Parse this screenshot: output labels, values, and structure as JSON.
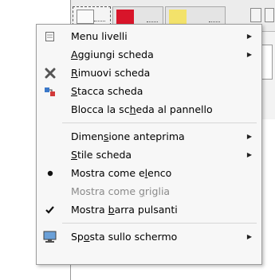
{
  "menu": {
    "items": [
      {
        "label": "Menu livelli",
        "icon": "layers-icon",
        "submenu": true,
        "enabled": true
      },
      {
        "label": "Aggiungi scheda",
        "underline": "A",
        "submenu": true,
        "enabled": true
      },
      {
        "label": "Rimuovi scheda",
        "underline": "R",
        "icon": "remove-x-icon",
        "enabled": true
      },
      {
        "label": "Stacca scheda",
        "underline": "S",
        "icon": "detach-icon",
        "enabled": true
      },
      {
        "label": "Blocca la scheda al pannello",
        "underline": "h",
        "enabled": true
      },
      {
        "label": "Dimensione anteprima",
        "underline": "s",
        "submenu": true,
        "enabled": true
      },
      {
        "label": "Stile scheda",
        "underline": "S",
        "submenu": true,
        "enabled": true
      },
      {
        "label": "Mostra come elenco",
        "underline": "l",
        "icon": "radio-dot-icon",
        "enabled": true
      },
      {
        "label": "Mostra come griglia",
        "underline": "g",
        "enabled": false
      },
      {
        "label": "Mostra barra pulsanti",
        "underline": "b",
        "icon": "check-icon",
        "enabled": true
      },
      {
        "label": "Sposta sullo schermo",
        "underline": "o",
        "icon": "monitor-icon",
        "submenu": true,
        "enabled": true
      }
    ]
  },
  "colors": {
    "menu_bg": "#f7f7f7",
    "disabled_text": "#8a8a8a",
    "tab2_thumb": "#d8152a",
    "tab3_thumb": "#f3e26a"
  }
}
